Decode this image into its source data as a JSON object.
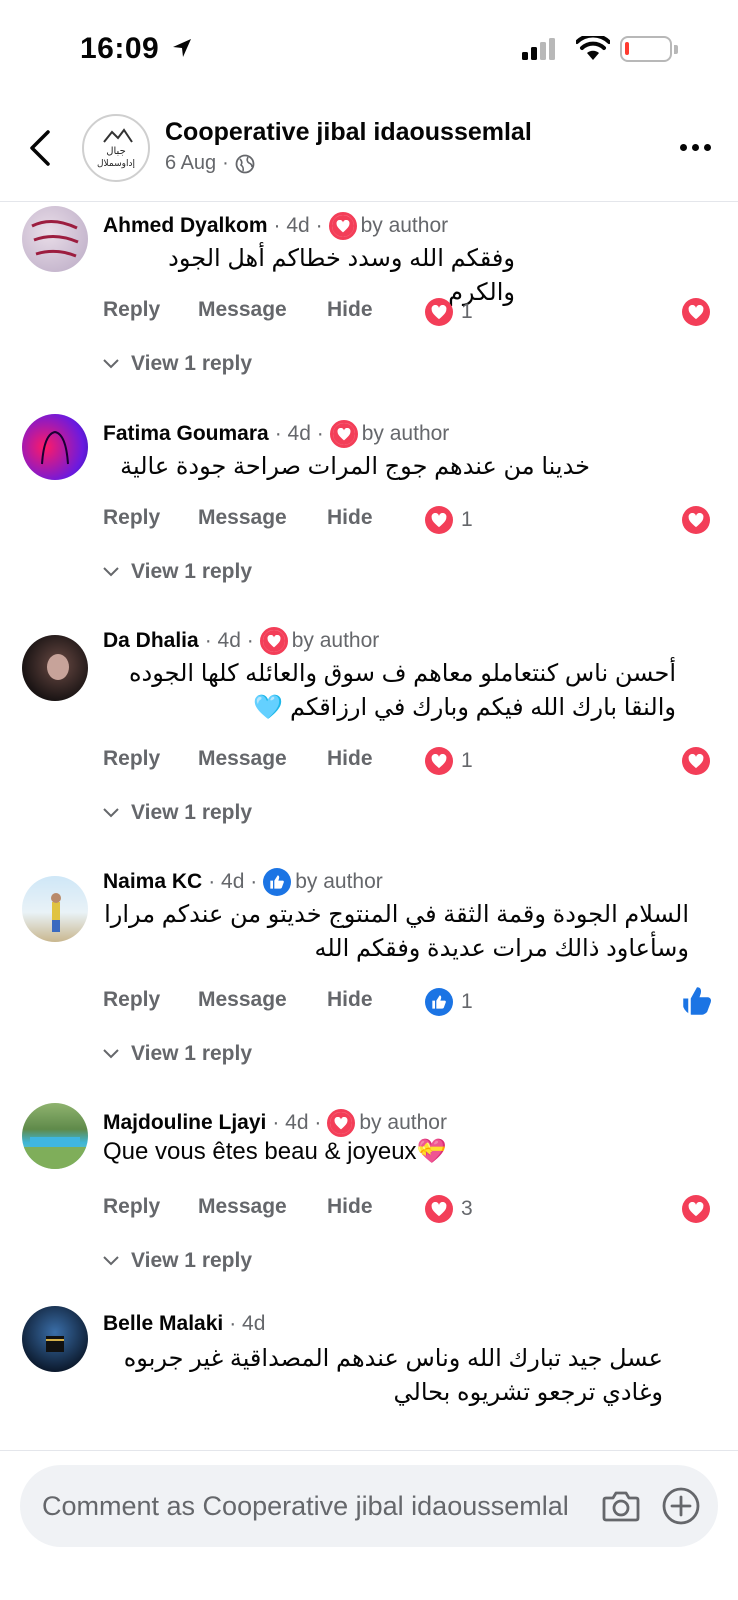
{
  "status_bar": {
    "time": "16:09"
  },
  "header": {
    "title": "Cooperative jibal idaoussemlal",
    "date": "6 Aug",
    "separator": "·",
    "avatar_text_top": "جبال",
    "avatar_text_bottom": "إداوسملال"
  },
  "actions": {
    "reply": "Reply",
    "message": "Message",
    "hide": "Hide"
  },
  "comments": [
    {
      "name": "Ahmed Dyalkom",
      "time": "· 4d ·",
      "author_reaction": "love",
      "by_author": "by author",
      "text": "وفقكم الله وسدد خطاكم أهل الجود والكرم",
      "reaction_type": "love",
      "reaction_count": "1",
      "view_replies": "View 1 reply"
    },
    {
      "name": "Fatima Goumara",
      "time": "· 4d ·",
      "author_reaction": "love",
      "by_author": "by author",
      "text": "خدينا من عندهم جوج المرات صراحة جودة عالية",
      "reaction_type": "love",
      "reaction_count": "1",
      "view_replies": "View 1 reply"
    },
    {
      "name": "Da Dhalia",
      "time": "· 4d ·",
      "author_reaction": "love",
      "by_author": "by author",
      "text_line1": "أحسن ناس كنتعاملو معاهم ف سوق  والعائله كلها  الجوده",
      "text_line2": "والنقا بارك الله فيكم وبارك في ارزاقكم 🩵",
      "reaction_type": "love",
      "reaction_count": "1",
      "view_replies": "View 1 reply"
    },
    {
      "name": "Naima KC",
      "time": "· 4d ·",
      "author_reaction": "like",
      "by_author": "by author",
      "text_line1": "السلام الجودة وقمة الثقة في المنتوج خديتو من عندكم مرارا",
      "text_line2": "وسأعاود ذالك مرات عديدة وفقكم الله",
      "reaction_type": "like",
      "reaction_count": "1",
      "view_replies": "View 1 reply"
    },
    {
      "name": "Majdouline Ljayi",
      "time": "· 4d ·",
      "author_reaction": "love",
      "by_author": "by author",
      "text": "Que vous êtes beau & joyeux💝",
      "reaction_type": "love",
      "reaction_count": "3",
      "view_replies": "View 1 reply"
    },
    {
      "name": "Belle Malaki",
      "time": "· 4d",
      "text_line1": "عسل جيد تبارك الله  وناس عندهم المصداقية  غير جربوه",
      "text_line2": "وغادي ترجعو تشريوه بحالي"
    }
  ],
  "composer": {
    "placeholder": "Comment as Cooperative jibal idaoussemlal"
  },
  "colors": {
    "love": "#f33e58",
    "like": "#1b74e4",
    "secondary_text": "#65676b"
  },
  "icons": [
    "location-arrow-icon",
    "signal-icon",
    "wifi-icon",
    "battery-icon",
    "back-chevron-icon",
    "globe-icon",
    "more-icon",
    "heart-icon",
    "thumbs-up-icon",
    "chevron-down-icon",
    "camera-icon",
    "plus-circle-icon"
  ]
}
